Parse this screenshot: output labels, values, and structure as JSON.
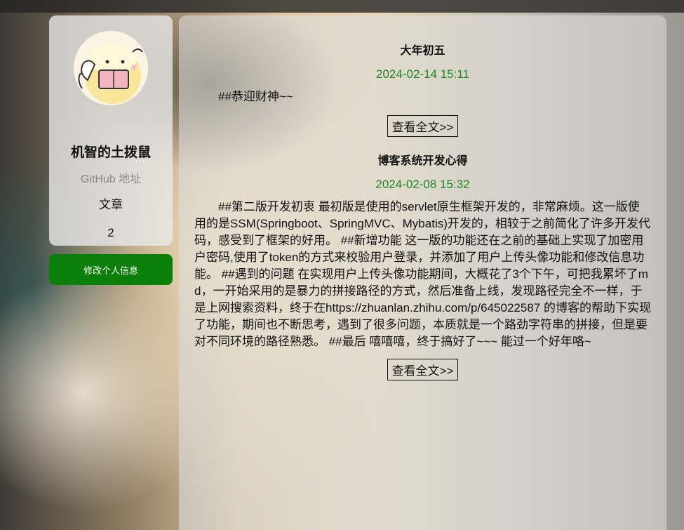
{
  "profile": {
    "username": "机智的土拨鼠",
    "github_link": "GitHub 地址",
    "articles_label": "文章",
    "articles_count": "2"
  },
  "actions": {
    "edit_profile": "修改个人信息"
  },
  "posts": [
    {
      "title": "大年初五",
      "date": "2024-02-14 15:11",
      "excerpt": "##恭迎财神~~",
      "read_more": "查看全文>>"
    },
    {
      "title": "博客系统开发心得",
      "date": "2024-02-08 15:32",
      "excerpt": "##第二版开发初衷 最初版是使用的servlet原生框架开发的，非常麻烦。这一版使用的是SSM(Springboot、SpringMVC、Mybatis)开发的，相较于之前简化了许多开发代码，感受到了框架的好用。 ##新增功能 这一版的功能还在之前的基础上实现了加密用户密码,使用了token的方式来校验用户登录，并添加了用户上传头像功能和修改信息功能。 ##遇到的问题 在实现用户上传头像功能期间，大概花了3个下午，可把我累坏了md，一开始采用的是暴力的拼接路径的方式，然后准备上线，发现路径完全不一样，于是上网搜索资料，终于在https://zhuanlan.zhihu.com/p/645022587 的博客的帮助下实现了功能，期间也不断思考，遇到了很多问题，本质就是一个路劲字符串的拼接，但是要对不同环境的路径熟悉。 ##最后 嘻嘻嘻，终于搞好了~~~ 能过一个好年咯~",
      "read_more": "查看全文>>"
    }
  ]
}
